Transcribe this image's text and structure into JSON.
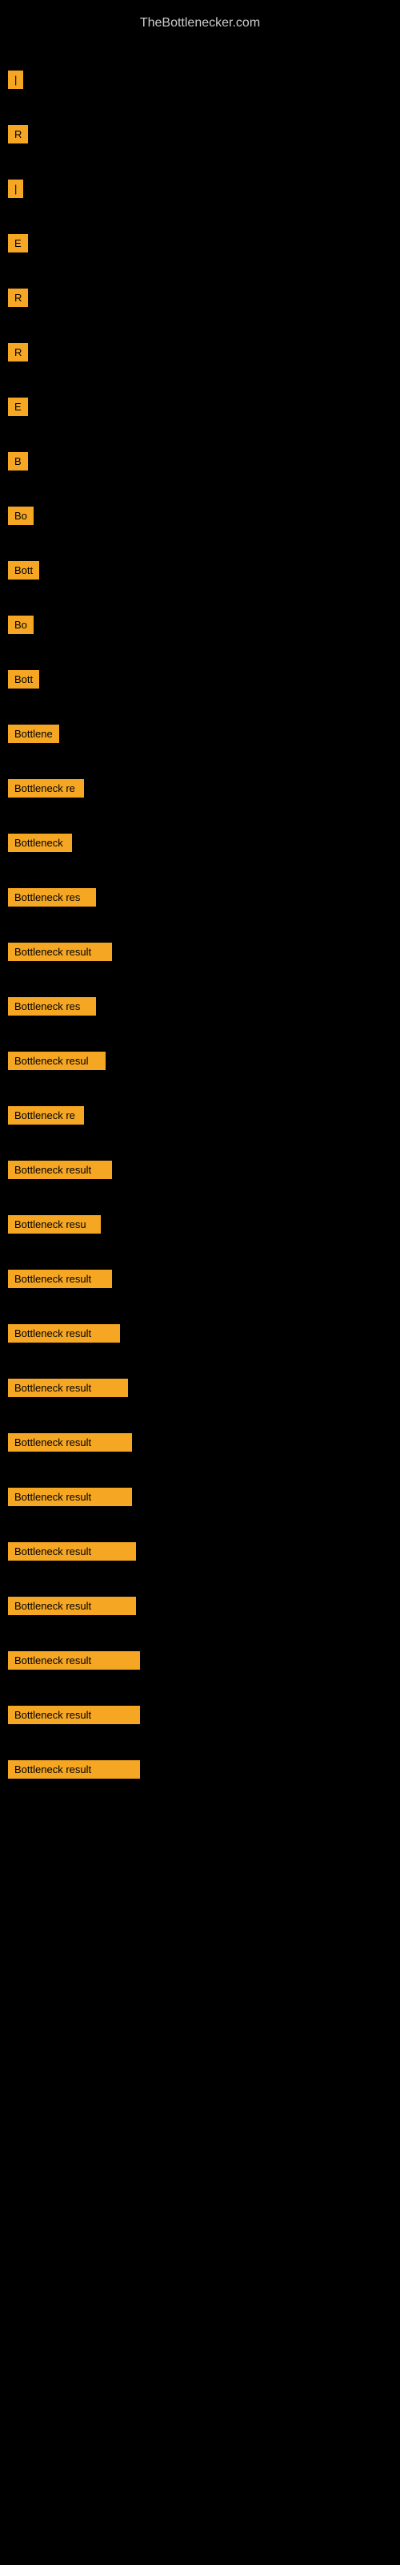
{
  "site": {
    "title": "TheBottlenecker.com"
  },
  "rows": [
    {
      "id": 1,
      "label": "|",
      "width": 5
    },
    {
      "id": 2,
      "label": "R",
      "width": 8
    },
    {
      "id": 3,
      "label": "|",
      "width": 5
    },
    {
      "id": 4,
      "label": "E",
      "width": 8
    },
    {
      "id": 5,
      "label": "R",
      "width": 8
    },
    {
      "id": 6,
      "label": "R",
      "width": 8
    },
    {
      "id": 7,
      "label": "E",
      "width": 8
    },
    {
      "id": 8,
      "label": "B",
      "width": 10
    },
    {
      "id": 9,
      "label": "Bo",
      "width": 18
    },
    {
      "id": 10,
      "label": "Bott",
      "width": 30
    },
    {
      "id": 11,
      "label": "Bo",
      "width": 18
    },
    {
      "id": 12,
      "label": "Bott",
      "width": 30
    },
    {
      "id": 13,
      "label": "Bottlene",
      "width": 60
    },
    {
      "id": 14,
      "label": "Bottleneck re",
      "width": 95
    },
    {
      "id": 15,
      "label": "Bottleneck",
      "width": 80
    },
    {
      "id": 16,
      "label": "Bottleneck res",
      "width": 110
    },
    {
      "id": 17,
      "label": "Bottleneck result",
      "width": 130
    },
    {
      "id": 18,
      "label": "Bottleneck res",
      "width": 110
    },
    {
      "id": 19,
      "label": "Bottleneck resul",
      "width": 122
    },
    {
      "id": 20,
      "label": "Bottleneck re",
      "width": 95
    },
    {
      "id": 21,
      "label": "Bottleneck result",
      "width": 130
    },
    {
      "id": 22,
      "label": "Bottleneck resu",
      "width": 116
    },
    {
      "id": 23,
      "label": "Bottleneck result",
      "width": 130
    },
    {
      "id": 24,
      "label": "Bottleneck result",
      "width": 140
    },
    {
      "id": 25,
      "label": "Bottleneck result",
      "width": 150
    },
    {
      "id": 26,
      "label": "Bottleneck result",
      "width": 155
    },
    {
      "id": 27,
      "label": "Bottleneck result",
      "width": 155
    },
    {
      "id": 28,
      "label": "Bottleneck result",
      "width": 160
    },
    {
      "id": 29,
      "label": "Bottleneck result",
      "width": 160
    },
    {
      "id": 30,
      "label": "Bottleneck result",
      "width": 165
    },
    {
      "id": 31,
      "label": "Bottleneck result",
      "width": 165
    },
    {
      "id": 32,
      "label": "Bottleneck result",
      "width": 165
    }
  ],
  "colors": {
    "background": "#000000",
    "label_bg": "#F5A623",
    "label_text": "#000000",
    "title_text": "#cccccc"
  }
}
